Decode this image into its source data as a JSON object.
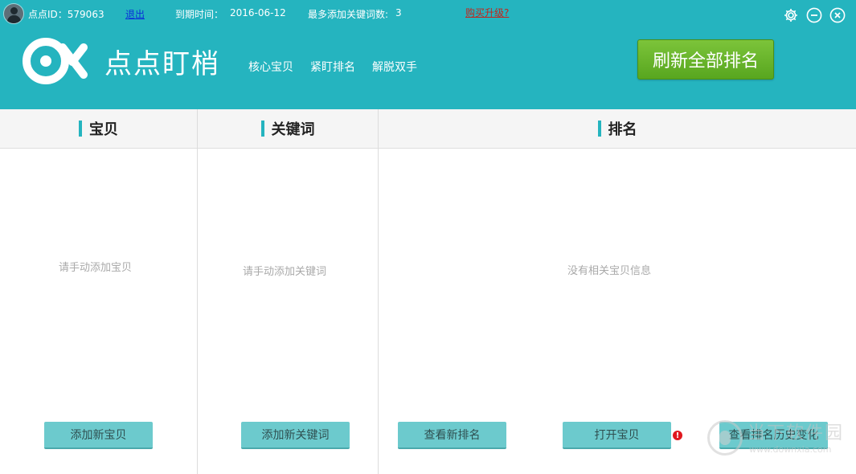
{
  "topbar": {
    "user_id": "点点ID：579063",
    "logout": "退出",
    "expiry_label": "到期时间：",
    "expiry_date": "2016-06-12",
    "max_keywords_label": "最多添加关键词数:",
    "max_keywords_value": "3",
    "upgrade": "购买升级?"
  },
  "header": {
    "app_name": "点点盯梢",
    "nav": [
      "核心宝贝",
      "紧盯排名",
      "解脱双手"
    ],
    "refresh_button": "刷新全部排名"
  },
  "columns": {
    "item": {
      "title": "宝贝",
      "empty": "请手动添加宝贝",
      "button": "添加新宝贝"
    },
    "keyword": {
      "title": "关键词",
      "empty": "请手动添加关键词",
      "button": "添加新关键词"
    },
    "rank": {
      "title": "排名",
      "empty": "没有相关宝贝信息",
      "buttons": [
        "查看新排名",
        "打开宝贝",
        "查看排名历史变化"
      ],
      "alert": "!"
    }
  },
  "watermark": {
    "title": "当下软件园",
    "url": "www.downxia.com"
  },
  "colors": {
    "header_bg": "#25b4bf",
    "refresh_btn": "#6db52c",
    "action_btn": "#6ccacd",
    "link_blue": "#0a2fd8",
    "link_red": "#c2261d"
  },
  "icons": [
    "user-avatar-icon",
    "settings-gear-icon",
    "minimize-icon",
    "close-icon",
    "app-logo-icon",
    "alert-icon"
  ]
}
